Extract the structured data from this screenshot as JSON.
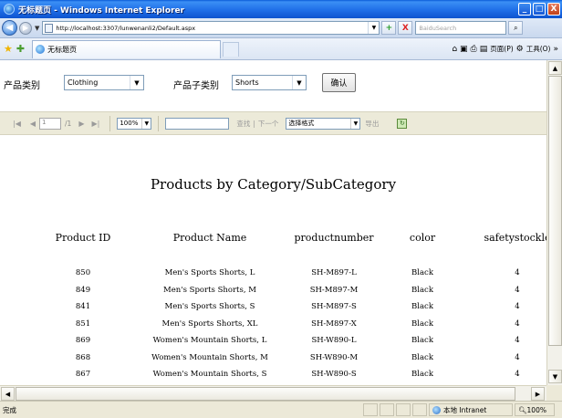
{
  "window": {
    "title": "无标题页 - Windows Internet Explorer",
    "minimize": "_",
    "maximize": "□",
    "close": "X"
  },
  "addressbar": {
    "url": "http://localhost:3307/lunwenanli2/Default.aspx",
    "refresh_icon": "+",
    "stop_icon": "X",
    "search_placeholder": "BaiduSearch",
    "search_go_icon": "search-icon"
  },
  "tabs": {
    "active_tab": "无标题页"
  },
  "commandbar": {
    "page_label": "页面(P)",
    "tools_label": "工具(O)"
  },
  "filters": {
    "category_label": "产品类别",
    "category_value": "Clothing",
    "subcategory_label": "产品子类别",
    "subcategory_value": "Shorts",
    "confirm_label": "确认"
  },
  "report_toolbar": {
    "first": "|◀",
    "prev": "◀",
    "page_current": "1",
    "page_total": "/1",
    "next": "▶",
    "last": "▶|",
    "zoom": "100%",
    "find_label": "查找",
    "find_sep": "|",
    "find_next_label": "下一个",
    "format_placeholder": "选择格式",
    "export_label": "导出"
  },
  "report": {
    "title": "Products by Category/SubCategory",
    "columns": [
      "Product ID",
      "Product Name",
      "productnumber",
      "color",
      "safetystockle"
    ],
    "rows": [
      [
        "850",
        "Men's Sports Shorts, L",
        "SH-M897-L",
        "Black",
        "4"
      ],
      [
        "849",
        "Men's Sports Shorts, M",
        "SH-M897-M",
        "Black",
        "4"
      ],
      [
        "841",
        "Men's Sports Shorts, S",
        "SH-M897-S",
        "Black",
        "4"
      ],
      [
        "851",
        "Men's Sports Shorts, XL",
        "SH-M897-X",
        "Black",
        "4"
      ],
      [
        "869",
        "Women's Mountain Shorts, L",
        "SH-W890-L",
        "Black",
        "4"
      ],
      [
        "868",
        "Women's Mountain Shorts, M",
        "SH-W890-M",
        "Black",
        "4"
      ],
      [
        "867",
        "Women's Mountain Shorts, S",
        "SH-W890-S",
        "Black",
        "4"
      ]
    ]
  },
  "statusbar": {
    "status": "完成",
    "zone": "本地 Intranet",
    "zoom": "100%"
  },
  "colors": {
    "titlebar": "#1f6fe8",
    "toolbar_bg": "#ecead9"
  }
}
